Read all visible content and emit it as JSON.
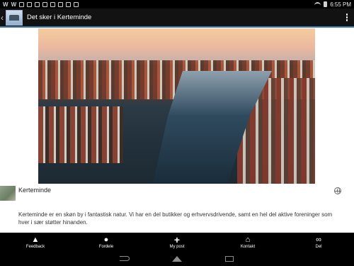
{
  "status_bar": {
    "left_icons": [
      "W",
      "W",
      "app-icon",
      "app-icon",
      "app-icon",
      "app-icon",
      "image-icon",
      "image-icon",
      "photo-icon",
      "sd-icon"
    ],
    "time": "6:55 PM"
  },
  "action_bar": {
    "title": "Det sker i Kerteminde"
  },
  "post": {
    "author": "Kerteminde",
    "body": "Kerteminde er en skøn by i fantastisk natur. Vi har en del butikker og erhvervsdrivende, samt en hel del aktive foreninger som hver i sær støtter hinanden."
  },
  "bottom_nav": {
    "items": [
      {
        "label": "Feedback",
        "icon": "thumbs-up-icon"
      },
      {
        "label": "Fordele",
        "icon": "money-bag-icon"
      },
      {
        "label": "My post",
        "icon": "plus-icon"
      },
      {
        "label": "Kontakt",
        "icon": "home-icon"
      },
      {
        "label": "Del",
        "icon": "share-icon"
      }
    ]
  }
}
